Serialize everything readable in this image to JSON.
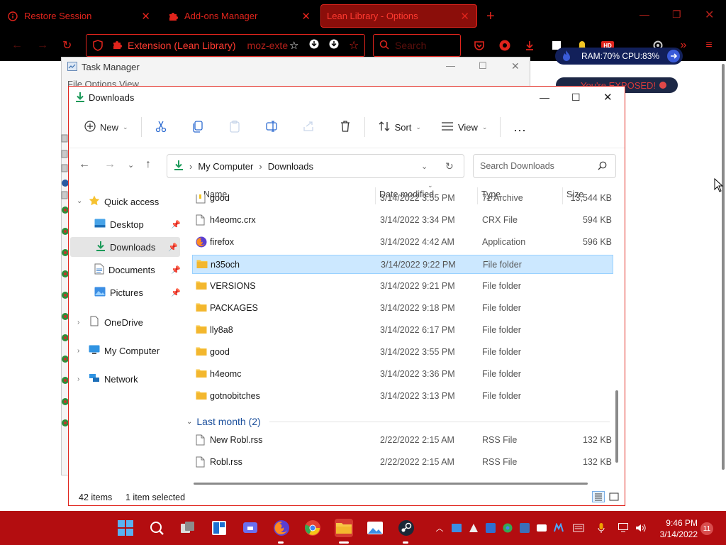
{
  "browser": {
    "tabs": [
      {
        "label": "Restore Session",
        "icon": "info-icon"
      },
      {
        "label": "Add-ons Manager",
        "icon": "puzzle-icon"
      },
      {
        "label": "Lean Library - Options",
        "icon": "lean-library-icon",
        "active": true
      }
    ],
    "url_label": "Extension (Lean Library)",
    "url_text": "moz-exte",
    "search_placeholder": "Search",
    "ram_cpu": "RAM:70%  CPU:83%",
    "exposed": "You're EXPOSED!",
    "accent_color": "#e0241c"
  },
  "taskmgr": {
    "title": "Task Manager",
    "menu": "File   Options   View"
  },
  "explorer": {
    "title": "Downloads",
    "toolbar": {
      "new": "New",
      "sort": "Sort",
      "view": "View",
      "more": "..."
    },
    "breadcrumb": [
      "My Computer",
      "Downloads"
    ],
    "search_placeholder": "Search Downloads",
    "nav": {
      "quick_access": "Quick access",
      "desktop": "Desktop",
      "downloads": "Downloads",
      "documents": "Documents",
      "pictures": "Pictures",
      "onedrive": "OneDrive",
      "my_computer": "My Computer",
      "network": "Network"
    },
    "columns": {
      "name": "Name",
      "date": "Date modified",
      "type": "Type",
      "size": "Size"
    },
    "rows": [
      {
        "name": "good",
        "date": "3/14/2022 3:55 PM",
        "type": "7z Archive",
        "size": "13,544 KB",
        "icon": "archive-icon"
      },
      {
        "name": "h4eomc.crx",
        "date": "3/14/2022 3:34 PM",
        "type": "CRX File",
        "size": "594 KB",
        "icon": "file-icon"
      },
      {
        "name": "firefox",
        "date": "3/14/2022 4:42 AM",
        "type": "Application",
        "size": "596 KB",
        "icon": "firefox-icon"
      },
      {
        "name": "n35och",
        "date": "3/14/2022 9:22 PM",
        "type": "File folder",
        "size": "",
        "icon": "folder-icon",
        "selected": true
      },
      {
        "name": "VERSIONS",
        "date": "3/14/2022 9:21 PM",
        "type": "File folder",
        "size": "",
        "icon": "folder-icon"
      },
      {
        "name": "PACKAGES",
        "date": "3/14/2022 9:18 PM",
        "type": "File folder",
        "size": "",
        "icon": "folder-icon"
      },
      {
        "name": "lly8a8",
        "date": "3/14/2022 6:17 PM",
        "type": "File folder",
        "size": "",
        "icon": "folder-icon"
      },
      {
        "name": "good",
        "date": "3/14/2022 3:55 PM",
        "type": "File folder",
        "size": "",
        "icon": "folder-icon"
      },
      {
        "name": "h4eomc",
        "date": "3/14/2022 3:36 PM",
        "type": "File folder",
        "size": "",
        "icon": "folder-icon"
      },
      {
        "name": "gotnobitches",
        "date": "3/14/2022 3:13 PM",
        "type": "File folder",
        "size": "",
        "icon": "folder-icon"
      }
    ],
    "group_last_month": "Last month (2)",
    "rows_last_month": [
      {
        "name": "New Robl.rss",
        "date": "2/22/2022 2:15 AM",
        "type": "RSS File",
        "size": "132 KB",
        "icon": "file-icon"
      },
      {
        "name": "Robl.rss",
        "date": "2/22/2022 2:15 AM",
        "type": "RSS File",
        "size": "132 KB",
        "icon": "file-icon"
      }
    ],
    "status": {
      "items": "42 items",
      "selected": "1 item selected"
    }
  },
  "taskbar": {
    "time": "9:46 PM",
    "date": "3/14/2022",
    "notifications": "11",
    "color": "#b30d10"
  }
}
